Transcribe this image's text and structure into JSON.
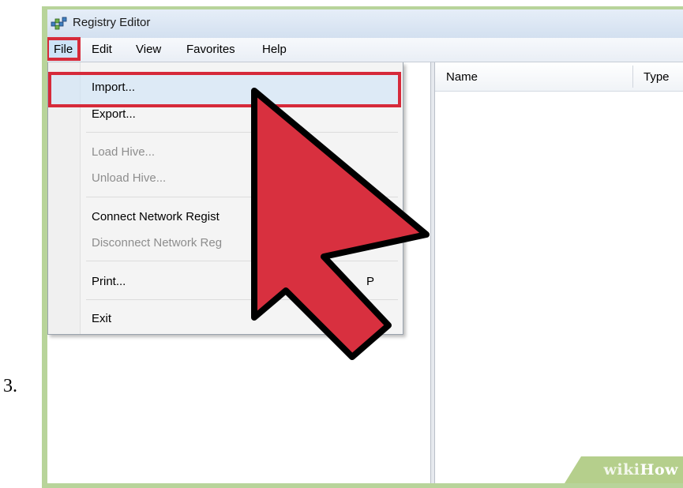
{
  "step": {
    "number": "3."
  },
  "window": {
    "title": "Registry Editor",
    "icon": "registry-icon"
  },
  "menubar": {
    "items": [
      "File",
      "Edit",
      "View",
      "Favorites",
      "Help"
    ]
  },
  "file_menu": {
    "import": "Import...",
    "export": "Export...",
    "load_hive": "Load Hive...",
    "unload_hive": "Unload Hive...",
    "connect": "Connect Network Regist",
    "disconnect": "Disconnect Network Reg",
    "print": "Print...",
    "print_shortcut": "P",
    "exit": "Exit"
  },
  "list": {
    "columns": [
      "Name",
      "Type"
    ]
  },
  "watermark": {
    "prefix": "wiki",
    "suffix": "How"
  },
  "colors": {
    "highlight": "#d62a3a",
    "arrow": "#d8303f",
    "frame": "#b8d49a"
  }
}
